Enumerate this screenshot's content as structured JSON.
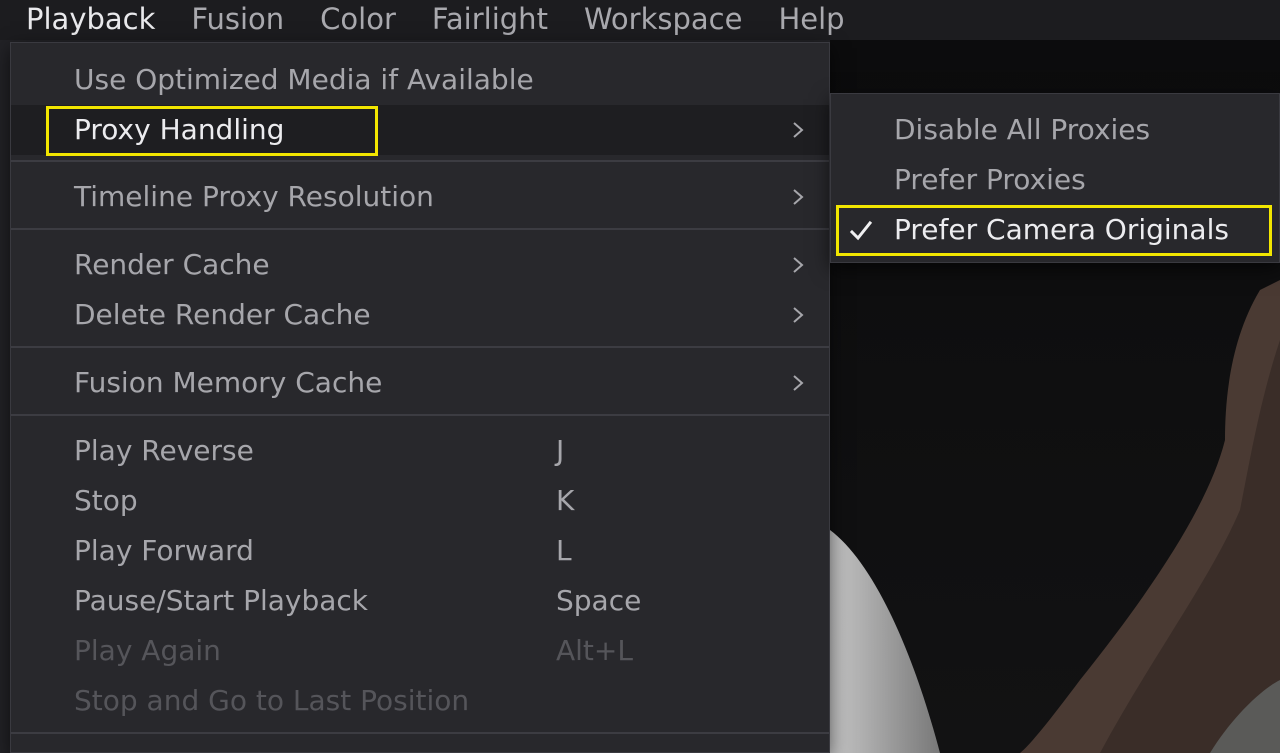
{
  "menubar": {
    "items": [
      {
        "label": "Playback",
        "active": true
      },
      {
        "label": "Fusion"
      },
      {
        "label": "Color"
      },
      {
        "label": "Fairlight"
      },
      {
        "label": "Workspace"
      },
      {
        "label": "Help"
      }
    ]
  },
  "playback_menu": {
    "items": [
      {
        "label": "Use Optimized Media if Available"
      },
      {
        "label": "Proxy Handling",
        "has_submenu": true,
        "highlighted": true
      },
      {
        "label": "Timeline Proxy Resolution",
        "has_submenu": true
      },
      {
        "label": "Render Cache",
        "has_submenu": true
      },
      {
        "label": "Delete Render Cache",
        "has_submenu": true
      },
      {
        "label": "Fusion Memory Cache",
        "has_submenu": true
      },
      {
        "label": "Play Reverse",
        "shortcut": "J"
      },
      {
        "label": "Stop",
        "shortcut": "K"
      },
      {
        "label": "Play Forward",
        "shortcut": "L"
      },
      {
        "label": "Pause/Start Playback",
        "shortcut": "Space"
      },
      {
        "label": "Play Again",
        "shortcut": "Alt+L",
        "disabled": true
      },
      {
        "label": "Stop and Go to Last Position",
        "disabled": true
      }
    ]
  },
  "proxy_submenu": {
    "items": [
      {
        "label": "Disable All Proxies"
      },
      {
        "label": "Prefer Proxies"
      },
      {
        "label": "Prefer Camera Originals",
        "checked": true,
        "highlighted": true
      }
    ]
  },
  "colors": {
    "highlight": "#f2e600",
    "menu_bg": "#28282c",
    "text": "#a6a6ab",
    "text_active": "#ececef",
    "text_disabled": "#55555a"
  },
  "icons": {
    "chevron": "chevron-right-icon",
    "check": "checkmark-icon"
  }
}
